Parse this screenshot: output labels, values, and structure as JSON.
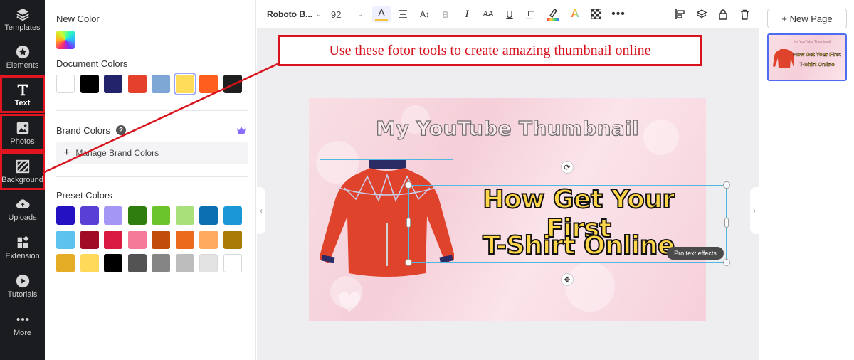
{
  "nav": {
    "items": [
      {
        "label": "Templates",
        "icon": "layers-icon"
      },
      {
        "label": "Elements",
        "icon": "star-icon"
      },
      {
        "label": "Text",
        "icon": "text-t-icon"
      },
      {
        "label": "Photos",
        "icon": "image-icon"
      },
      {
        "label": "Background",
        "icon": "background-stripes-icon"
      },
      {
        "label": "Uploads",
        "icon": "cloud-upload-icon"
      },
      {
        "label": "Extension",
        "icon": "extension-grid-icon"
      },
      {
        "label": "Tutorials",
        "icon": "play-icon"
      },
      {
        "label": "More",
        "icon": "more-dots-icon"
      }
    ],
    "active": "Text"
  },
  "panel": {
    "new_color_title": "New Color",
    "document_colors_title": "Document Colors",
    "document_colors": [
      "#ffffff",
      "#000000",
      "#23236b",
      "#e5402b",
      "#7ea7d6",
      "#ffdc5a",
      "#ff5e1e",
      "#1f1f1f"
    ],
    "selected_document_color": "#ffdc5a",
    "brand_colors_title": "Brand Colors",
    "manage_brand_label": "Manage Brand Colors",
    "preset_colors_title": "Preset Colors",
    "preset_colors": [
      "#2412c2",
      "#5a3fd6",
      "#a496f5",
      "#2f7d0d",
      "#6bc42b",
      "#a9e07a",
      "#0b6fb2",
      "#1a98d6",
      "#5ec2ee",
      "#a20b25",
      "#d9193f",
      "#f57a9a",
      "#c24d0b",
      "#ec6a1b",
      "#ffaa5c",
      "#a97a06",
      "#e5ad25",
      "#ffd959",
      "#000000",
      "#535353",
      "#858585",
      "#bdbdbd",
      "#e3e3e3",
      "#ffffff"
    ]
  },
  "toolbar": {
    "font_name": "Roboto B...",
    "font_size": "92",
    "text_color_bar": "#f2c43a"
  },
  "annotation": {
    "text": "Use these fotor tools to create amazing thumbnail online",
    "color": "#d8131d"
  },
  "design": {
    "title": "My YouTube Thumbnail",
    "headline_line1": "How Get Your First",
    "headline_line2": "T-Shirt Online",
    "pro_badge": "Pro text effects",
    "headline_color": "#ffd54a"
  },
  "pages": {
    "new_page_label": "+ New Page"
  }
}
